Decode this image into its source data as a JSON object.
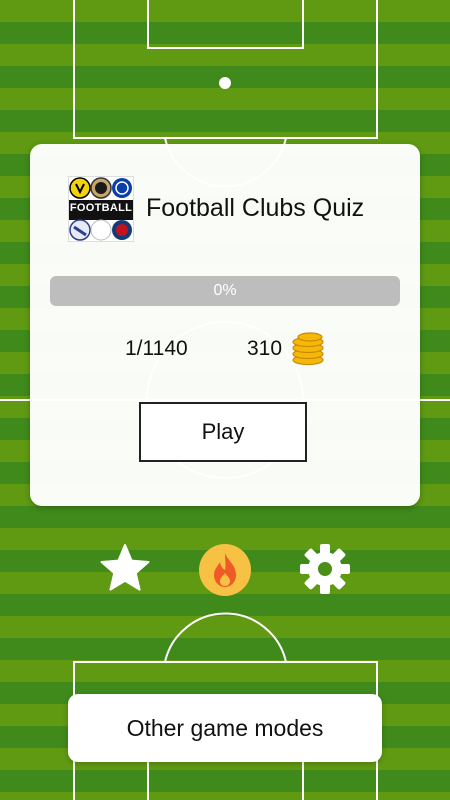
{
  "quiz": {
    "title": "Football Clubs Quiz",
    "logo_text": "FOOTBALL",
    "progress_label": "0%",
    "progress_value": 0,
    "levels_text": "1/1140",
    "coins_text": "310",
    "play_label": "Play"
  },
  "actions": {
    "favorites_icon": "star-icon",
    "streak_icon": "fire-icon",
    "settings_icon": "gear-icon",
    "other_modes_label": "Other game modes"
  },
  "colors": {
    "grass_light": "#5f9a12",
    "grass_dark": "#3f8a1a",
    "progress_track": "#bdbdbd",
    "fire_bg": "#f7c243",
    "fire_flame": "#f05a28",
    "coin": "#f5b80a"
  }
}
